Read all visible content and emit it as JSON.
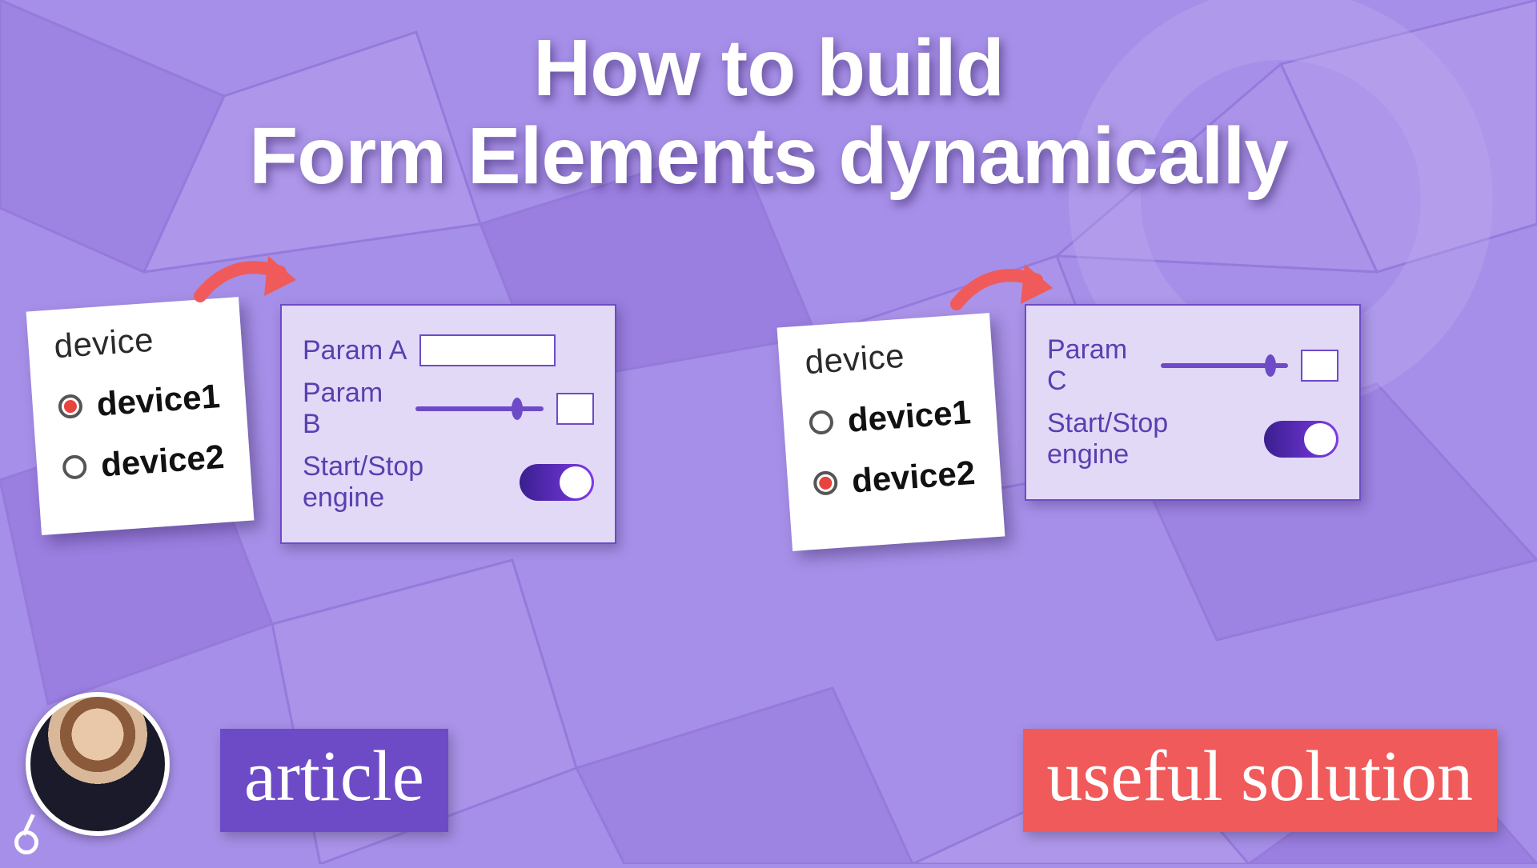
{
  "title_l1": "How to build",
  "title_l2": "Form Elements dynamically",
  "cards": {
    "hdr": "device",
    "opt1": "device1",
    "opt2": "device2"
  },
  "panel1": {
    "a": "Param A",
    "b": "Param B",
    "ss": "Start/Stop engine"
  },
  "panel2": {
    "c": "Param C",
    "ss": "Start/Stop engine"
  },
  "badges": {
    "article": "article",
    "solution": "useful solution"
  },
  "colors": {
    "accent": "#6d4bc7",
    "red": "#f05a5a",
    "bg": "#a68fe8"
  }
}
